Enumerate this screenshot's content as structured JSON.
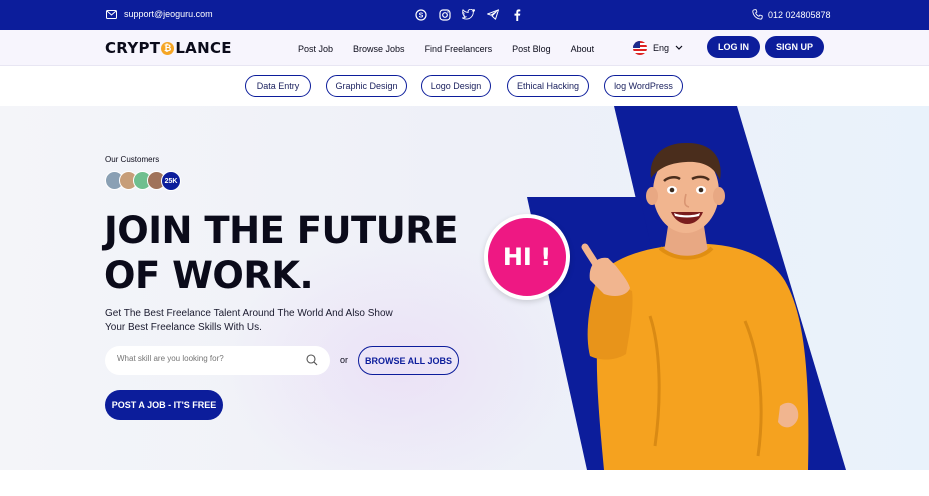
{
  "topbar": {
    "email": "support@jeoguru.com",
    "social_icons": [
      "skype-icon",
      "instagram-icon",
      "twitter-icon",
      "telegram-icon",
      "facebook-icon"
    ],
    "phone": "012 024805878"
  },
  "nav": {
    "logo_left": "CRYPT",
    "logo_coin": "₿",
    "logo_right": "LANCE",
    "menu": [
      "Post Job",
      "Browse Jobs",
      "Find Freelancers",
      "Post Blog",
      "About"
    ],
    "language": "Eng",
    "login": "LOG IN",
    "signup": "SIGN UP"
  },
  "categories": [
    "Data Entry",
    "Graphic Design",
    "Logo Design",
    "Ethical Hacking",
    "log WordPress"
  ],
  "hero": {
    "customers_label": "Our Customers",
    "customers_count": "25K",
    "headline_line1": "JOIN THE FUTURE",
    "headline_line2": "OF WORK.",
    "subtext_line1": "Get The Best Freelance Talent Around The World And Also Show",
    "subtext_line2": "Your Best Freelance Skills With Us.",
    "search_placeholder": "What skill are you looking for?",
    "or_label": "or",
    "browse_all": "BROWSE ALL JOBS",
    "post_job": "POST A JOB - IT'S FREE",
    "hi_badge": "HI !"
  },
  "colors": {
    "primary": "#0c1d9b",
    "accent_pink": "#ee1883",
    "sweater": "#f5a21f"
  }
}
